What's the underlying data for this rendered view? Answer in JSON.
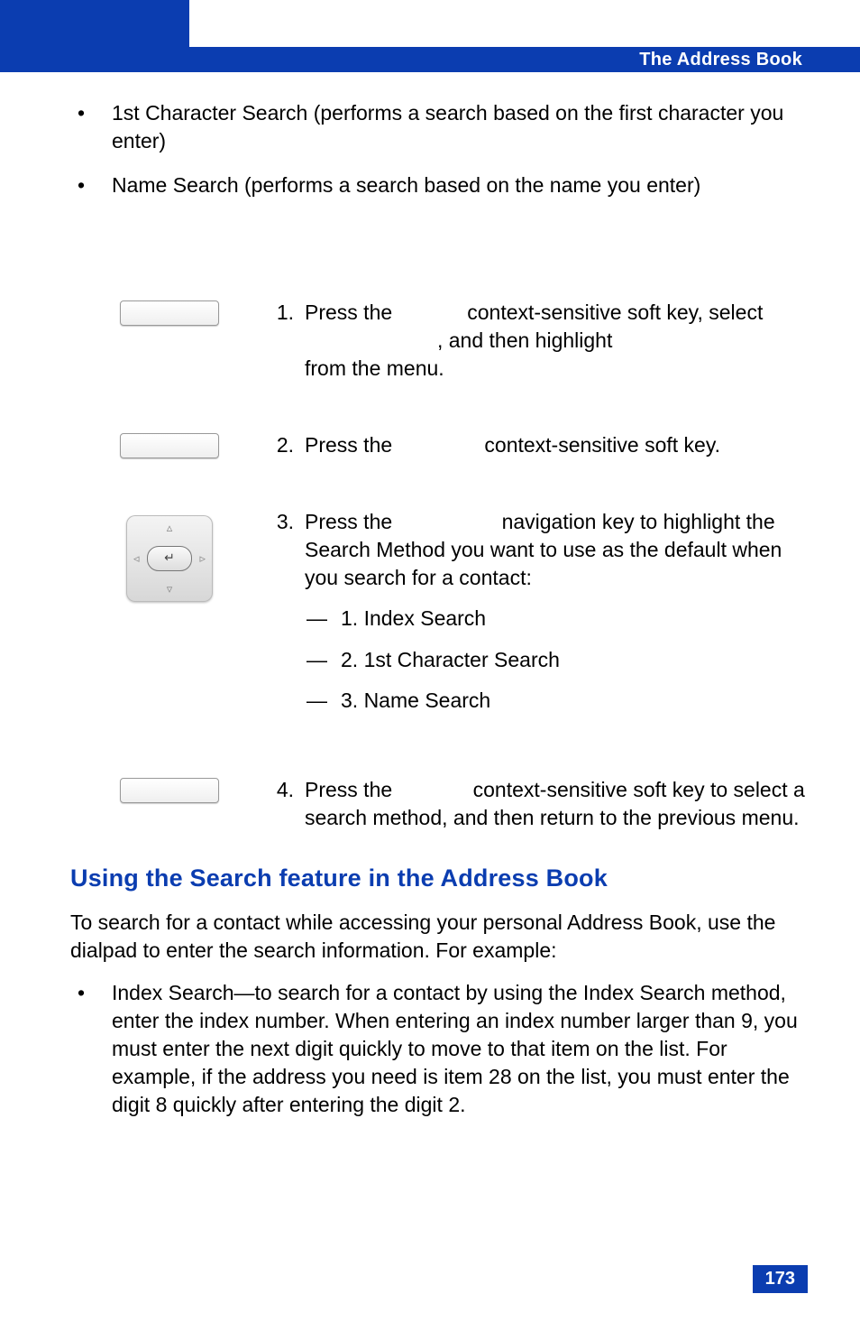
{
  "header": {
    "title": "The Address Book"
  },
  "top_bullets": [
    "1st Character Search (performs a search based on the first character you enter)",
    "Name Search (performs a search based on the name you enter)"
  ],
  "steps": [
    {
      "num": "1.",
      "parts": [
        "Press the ",
        " context-sensitive soft key, select ",
        ", and then highlight ",
        " from the menu."
      ]
    },
    {
      "num": "2.",
      "parts": [
        "Press the ",
        " context-sensitive soft key."
      ]
    },
    {
      "num": "3.",
      "parts": [
        "Press the ",
        " navigation key to highlight the Search Method you want to use as the default when you search for a contact:"
      ],
      "sub": [
        "1. Index Search",
        "2. 1st Character Search",
        "3. Name Search"
      ]
    },
    {
      "num": "4.",
      "parts": [
        "Press the ",
        " context-sensitive soft key to select a search method, and then return to the previous menu."
      ]
    }
  ],
  "section_heading": "Using the Search feature in the Address Book",
  "section_para": "To search for a contact while accessing your personal Address Book, use the dialpad to enter the search information. For example:",
  "section_bullets": [
    "Index Search—to search for a contact by using the Index Search method, enter the index number. When entering an index number larger than 9, you must enter the next digit quickly to move to that item on the list. For example, if the address you need is item 28 on the list, you must enter the digit 8 quickly after entering the digit 2."
  ],
  "page_number": "173"
}
